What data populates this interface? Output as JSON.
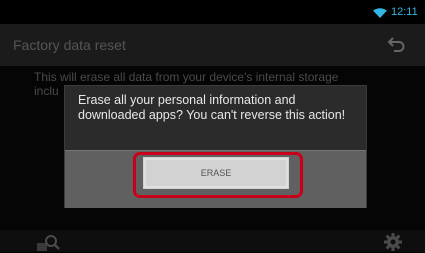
{
  "status_bar": {
    "time": "12:11",
    "wifi_icon": "wifi-icon",
    "clock_color": "#33b5e5"
  },
  "action_bar": {
    "title": "Factory data reset",
    "back_icon": "back-icon"
  },
  "content": {
    "description_line1": "This will erase all data from your device's internal storage",
    "description_line2": "inclu"
  },
  "dialog": {
    "message": "Erase all your personal information and downloaded apps? You can't reverse this action!",
    "erase_button_label": "ERASE"
  },
  "bottom_bar": {
    "left_icon": "search-icon",
    "right_icon": "settings-icon"
  },
  "highlight": {
    "color": "#c8001a"
  }
}
